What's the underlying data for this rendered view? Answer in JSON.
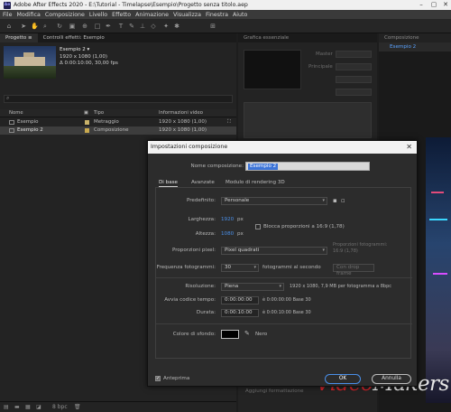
{
  "window": {
    "title": "Adobe After Effects 2020 - E:\\Tutorial - Timelapse\\Esempio\\Progetto senza titolo.aep",
    "logo": "Ae"
  },
  "menu": [
    "File",
    "Modifica",
    "Composizione",
    "Livello",
    "Effetto",
    "Animazione",
    "Visualizza",
    "Finestra",
    "Aiuto"
  ],
  "project": {
    "tabs": [
      "Progetto ≡",
      "Controlli effetti: Esempio"
    ],
    "comp_name": "Esempio 2 ▾",
    "comp_size": "1920 x 1080 (1,00)",
    "comp_duration": "Δ 0:00:10:00, 30,00 fps",
    "search_placeholder": "",
    "columns": [
      "Nome",
      "Tipo",
      "Informazioni video"
    ],
    "rows": [
      {
        "name": "Esempio",
        "type": "Metraggio",
        "info": "1920 x 1080 (1,00)",
        "color": "#c9b26a",
        "selected": false
      },
      {
        "name": "Esempio 2",
        "type": "Composizione",
        "info": "1920 x 1080 (1,00)",
        "color": "#c9a94f",
        "selected": true
      }
    ],
    "footer_bpc": "8 bpc"
  },
  "middle": {
    "tab": "Grafica essenziale",
    "labels": [
      "Master",
      "Principale"
    ],
    "apply_label": "Aggiungi formattazione"
  },
  "right": {
    "tab": "Composizione",
    "subtab": "Esempio 2"
  },
  "watermark": {
    "part1": "Video",
    "part2": "Makers"
  },
  "dialog": {
    "title": "Impostazioni composizione",
    "name_label": "Nome composizione:",
    "name_value": "Esempio 2",
    "tabs": [
      "Di base",
      "Avanzate",
      "Modulo di rendering 3D"
    ],
    "preset_label": "Predefinito:",
    "preset_value": "Personale",
    "width_label": "Larghezza:",
    "width_value": "1920",
    "width_unit": "px",
    "height_label": "Altezza:",
    "height_value": "1080",
    "height_unit": "px",
    "lock_label": "Blocca proporzioni a 16:9 (1,78)",
    "pixel_label": "Proporzioni pixel:",
    "pixel_value": "Pixel quadrati",
    "frame_ratio_label": "Proporzioni fotogrammi:",
    "frame_ratio_value": "16:9 (1,78)",
    "fps_label": "Frequenza fotogrammi:",
    "fps_value": "30",
    "fps_unit": "fotogrammi al secondo",
    "drop_frame": "Con drop frame",
    "res_label": "Risoluzione:",
    "res_value": "Piena",
    "res_info": "1920 x 1080, 7,9 MB per fotogramma a 8bpc",
    "start_label": "Avvia codice tempo:",
    "start_value": "0:00:00:00",
    "start_info": "è 0:00:00:00  Base 30",
    "dur_label": "Durata:",
    "dur_value": "0:00:10:00",
    "dur_info": "è 0:00:10:00  Base 30",
    "bg_label": "Colore di sfondo:",
    "bg_name": "Nero",
    "bg_color": "#000000",
    "preview_label": "Anteprima",
    "ok_label": "OK",
    "cancel_label": "Annulla"
  }
}
